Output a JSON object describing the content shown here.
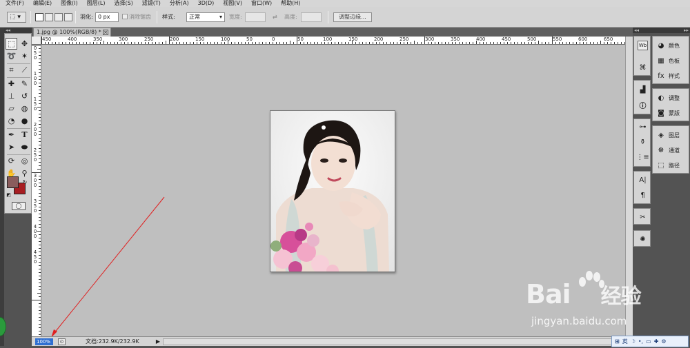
{
  "menubar": {
    "items": [
      "文件(F)",
      "编辑(E)",
      "图像(I)",
      "图层(L)",
      "选择(S)",
      "滤镜(T)",
      "分析(A)",
      "3D(D)",
      "视图(V)",
      "窗口(W)",
      "帮助(H)"
    ]
  },
  "options": {
    "feather_label": "羽化:",
    "feather_value": "0 px",
    "antialias_label": "消除锯齿",
    "style_label": "样式:",
    "style_value": "正常",
    "width_label": "宽度:",
    "height_label": "高度:",
    "refine_button": "调整边缘..."
  },
  "tools_header": "◂◂",
  "document": {
    "tab_title": "1.jpg @ 100%(RGB/8) *",
    "tab_close": "×"
  },
  "ruler_h": [
    "450",
    "400",
    "350",
    "300",
    "250",
    "200",
    "150",
    "100",
    "50",
    "0",
    "50",
    "100",
    "150",
    "200",
    "250",
    "300",
    "350",
    "400",
    "450",
    "500",
    "550",
    "600",
    "650"
  ],
  "ruler_v": [
    "0",
    "5",
    "0",
    "1",
    "0",
    "0",
    "1",
    "5",
    "0",
    "2",
    "0",
    "0",
    "2",
    "5",
    "0",
    "3",
    "0",
    "0",
    "3",
    "5",
    "0",
    "4",
    "0",
    "0",
    "4",
    "5",
    "0"
  ],
  "status": {
    "zoom": "100%",
    "doc_info": "文档:232.9K/232.9K"
  },
  "panels": {
    "groups": [
      {
        "items": [
          {
            "icon": "color-icon",
            "label": "颜色"
          },
          {
            "icon": "swatches-icon",
            "label": "色板"
          },
          {
            "icon": "styles-icon",
            "label": "样式"
          }
        ]
      },
      {
        "items": [
          {
            "icon": "adjustments-icon",
            "label": "调整"
          },
          {
            "icon": "masks-icon",
            "label": "蒙版"
          }
        ]
      },
      {
        "items": [
          {
            "icon": "layers-icon",
            "label": "图层"
          },
          {
            "icon": "channels-icon",
            "label": "通道"
          },
          {
            "icon": "paths-icon",
            "label": "路径"
          }
        ]
      }
    ]
  },
  "colors": {
    "foreground": "#8a5d5d",
    "background": "#a71e22",
    "canvas_bg": "#bfbfbf",
    "arrow": "#e02020"
  },
  "watermark": {
    "brand": "Bai",
    "brand_cn": "经验",
    "url": "jingyan.baidu.com"
  },
  "ime": {
    "lang": "英"
  }
}
